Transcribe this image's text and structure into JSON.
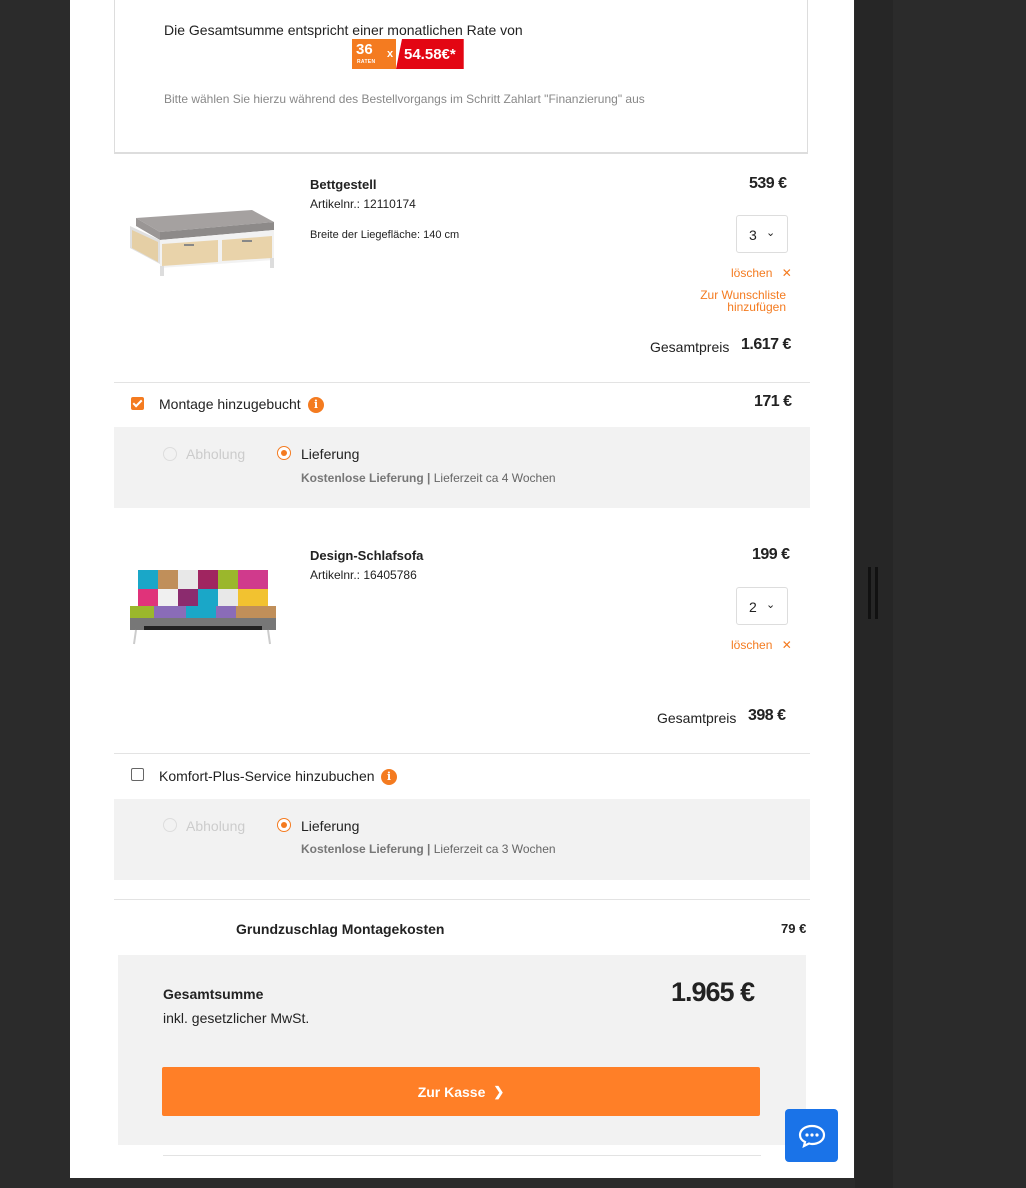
{
  "financing": {
    "text": "Die Gesamtsumme entspricht einer monatlichen Rate von",
    "months": "36",
    "months_label": "RATEN",
    "times": "x",
    "rate": "54.58€*",
    "note": "Bitte wählen Sie hierzu während des Bestellvorgangs im Schritt Zahlart \"Finanzierung\" aus"
  },
  "items": [
    {
      "title": "Bettgestell",
      "article": "Artikelnr.: 12110174",
      "attribute": "Breite der Liegefläche: 140 cm",
      "price": "539 €",
      "quantity": "3",
      "delete_label": "löschen",
      "wishlist_label": "Zur Wunschliste hinzufügen",
      "total_label": "Gesamtpreis",
      "total_value": "1.617 €",
      "service": {
        "label": "Montage hinzugebucht",
        "checked": true,
        "price": "171 €"
      },
      "delivery": {
        "pickup_label": "Abholung",
        "delivery_label": "Lieferung",
        "free_label": "Kostenlose Lieferung",
        "separator": "|",
        "time": "Lieferzeit ca 4 Wochen"
      }
    },
    {
      "title": "Design-Schlafsofa",
      "article": "Artikelnr.: 16405786",
      "price": "199 €",
      "quantity": "2",
      "delete_label": "löschen",
      "total_label": "Gesamtpreis",
      "total_value": "398 €",
      "service": {
        "label": "Komfort-Plus-Service hinzubuchen",
        "checked": false
      },
      "delivery": {
        "pickup_label": "Abholung",
        "delivery_label": "Lieferung",
        "free_label": "Kostenlose Lieferung",
        "separator": "|",
        "time": "Lieferzeit ca 3 Wochen"
      }
    }
  ],
  "surcharge": {
    "label": "Grundzuschlag Montagekosten",
    "value": "79 €"
  },
  "summary": {
    "title": "Gesamtsumme",
    "vat": "inkl. gesetzlicher MwSt.",
    "total": "1.965 €",
    "checkout_label": "Zur Kasse"
  },
  "icons": {
    "delete": "close-icon",
    "quantity": "chevron-down-icon",
    "info": "info-icon",
    "checkout": "chevron-right-icon",
    "chat": "chat-icon"
  },
  "colors": {
    "accent": "#f47b20",
    "rate_red": "#e30613",
    "button": "#ff7f27",
    "chat": "#1a73e8",
    "box_bg": "#f2f2f2"
  }
}
